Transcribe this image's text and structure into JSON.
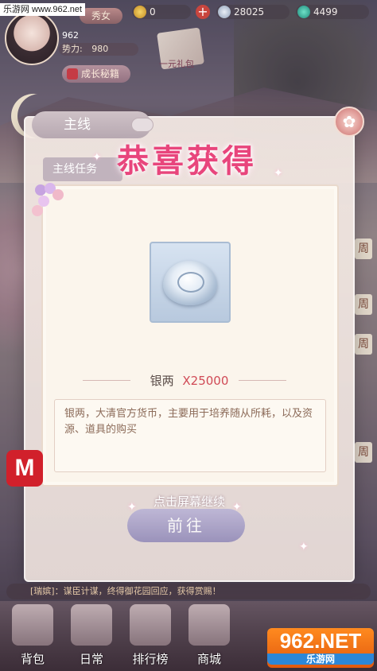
{
  "watermark": {
    "top_left": "乐游网 www.962.net",
    "bottom_right_main": "962.NET",
    "bottom_right_sub": "乐游网"
  },
  "hud": {
    "rank": "秀女",
    "player_id": "962",
    "power_label": "势力:",
    "power_value": "980",
    "growth_button": "成长秘籍",
    "gold": "0",
    "silver": "28025",
    "jade": "4499",
    "plus": "+",
    "quest_label": "一元礼包"
  },
  "panel": {
    "main_tab": "主线",
    "sub_tab": "主线任务",
    "title": "恭喜获得",
    "close_icon": "close-icon",
    "item": {
      "name": "银两",
      "quantity": "X25000",
      "icon": "silver-ingot-icon",
      "description": "银两，大清官方货币，主要用于培养随从所耗，以及资源、道具的购买"
    },
    "continue_hint": "点击屏幕继续",
    "go_button": "前往"
  },
  "side_tags": [
    "周",
    "周",
    "周",
    "周"
  ],
  "ticker": "[瑞嫔]：谋臣计谋，终得御花园回应，获得赏赐！",
  "bottom_nav": [
    {
      "label": "背包",
      "icon": "bag-icon"
    },
    {
      "label": "日常",
      "icon": "scroll-icon"
    },
    {
      "label": "排行榜",
      "icon": "ranking-icon"
    },
    {
      "label": "商城",
      "icon": "shop-icon"
    }
  ]
}
